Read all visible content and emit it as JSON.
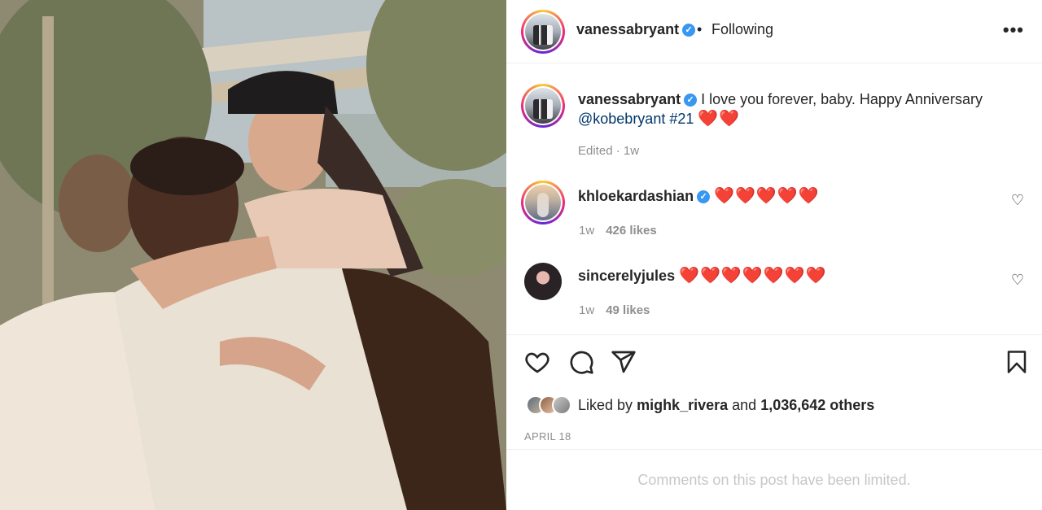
{
  "post": {
    "author": "vanessabryant",
    "follow_status": "Following",
    "bullet": "•",
    "more_label": "•••",
    "caption": {
      "username": "vanessabryant",
      "text": "I love you forever, baby. Happy Anniversary",
      "mention": "@kobebryant",
      "hashtag": "#21",
      "emoji": "❤️❤️",
      "meta": "Edited · 1w"
    },
    "comments": [
      {
        "username": "khloekardashian",
        "verified": true,
        "text": "❤️❤️❤️❤️❤️",
        "age": "1w",
        "likes": "426 likes"
      },
      {
        "username": "sincerelyjules",
        "verified": false,
        "text": "❤️❤️❤️❤️❤️❤️❤️",
        "age": "1w",
        "likes": "49 likes"
      }
    ],
    "likes_prefix": "Liked by",
    "liked_by_user": "mighk_rivera",
    "likes_and": "and",
    "likes_others": "1,036,642 others",
    "date": "APRIL 18",
    "comments_limited": "Comments on this post have been limited."
  },
  "icons": {
    "verified": "verified-badge-icon",
    "like": "heart-outline-icon",
    "comment": "speech-bubble-icon",
    "share": "paper-plane-icon",
    "save": "bookmark-icon",
    "more": "ellipsis-icon"
  },
  "colors": {
    "verified": "#3897f0",
    "mention": "#00376b",
    "heart": "#e0101d",
    "muted": "#8e8e8e"
  }
}
